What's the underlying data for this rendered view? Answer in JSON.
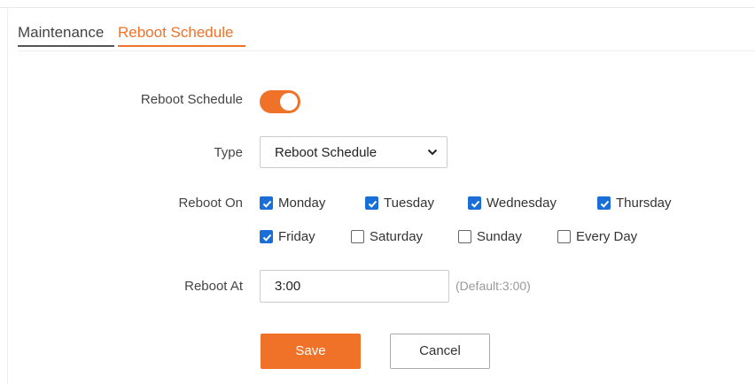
{
  "tabs": [
    {
      "label": "Maintenance",
      "active": false
    },
    {
      "label": "Reboot Schedule",
      "active": true
    }
  ],
  "form": {
    "reboot_schedule": {
      "label": "Reboot Schedule",
      "enabled": true
    },
    "type": {
      "label": "Type",
      "value": "Reboot Schedule"
    },
    "reboot_on": {
      "label": "Reboot On",
      "days": [
        {
          "label": "Monday",
          "checked": true
        },
        {
          "label": "Tuesday",
          "checked": true
        },
        {
          "label": "Wednesday",
          "checked": true
        },
        {
          "label": "Thursday",
          "checked": true
        },
        {
          "label": "Friday",
          "checked": true
        },
        {
          "label": "Saturday",
          "checked": false
        },
        {
          "label": "Sunday",
          "checked": false
        },
        {
          "label": "Every Day",
          "checked": false
        }
      ]
    },
    "reboot_at": {
      "label": "Reboot At",
      "value": "3:00",
      "hint": "(Default:3:00)"
    }
  },
  "buttons": {
    "save": "Save",
    "cancel": "Cancel"
  },
  "colors": {
    "accent": "#f07128",
    "checkbox": "#1a6ed8"
  }
}
